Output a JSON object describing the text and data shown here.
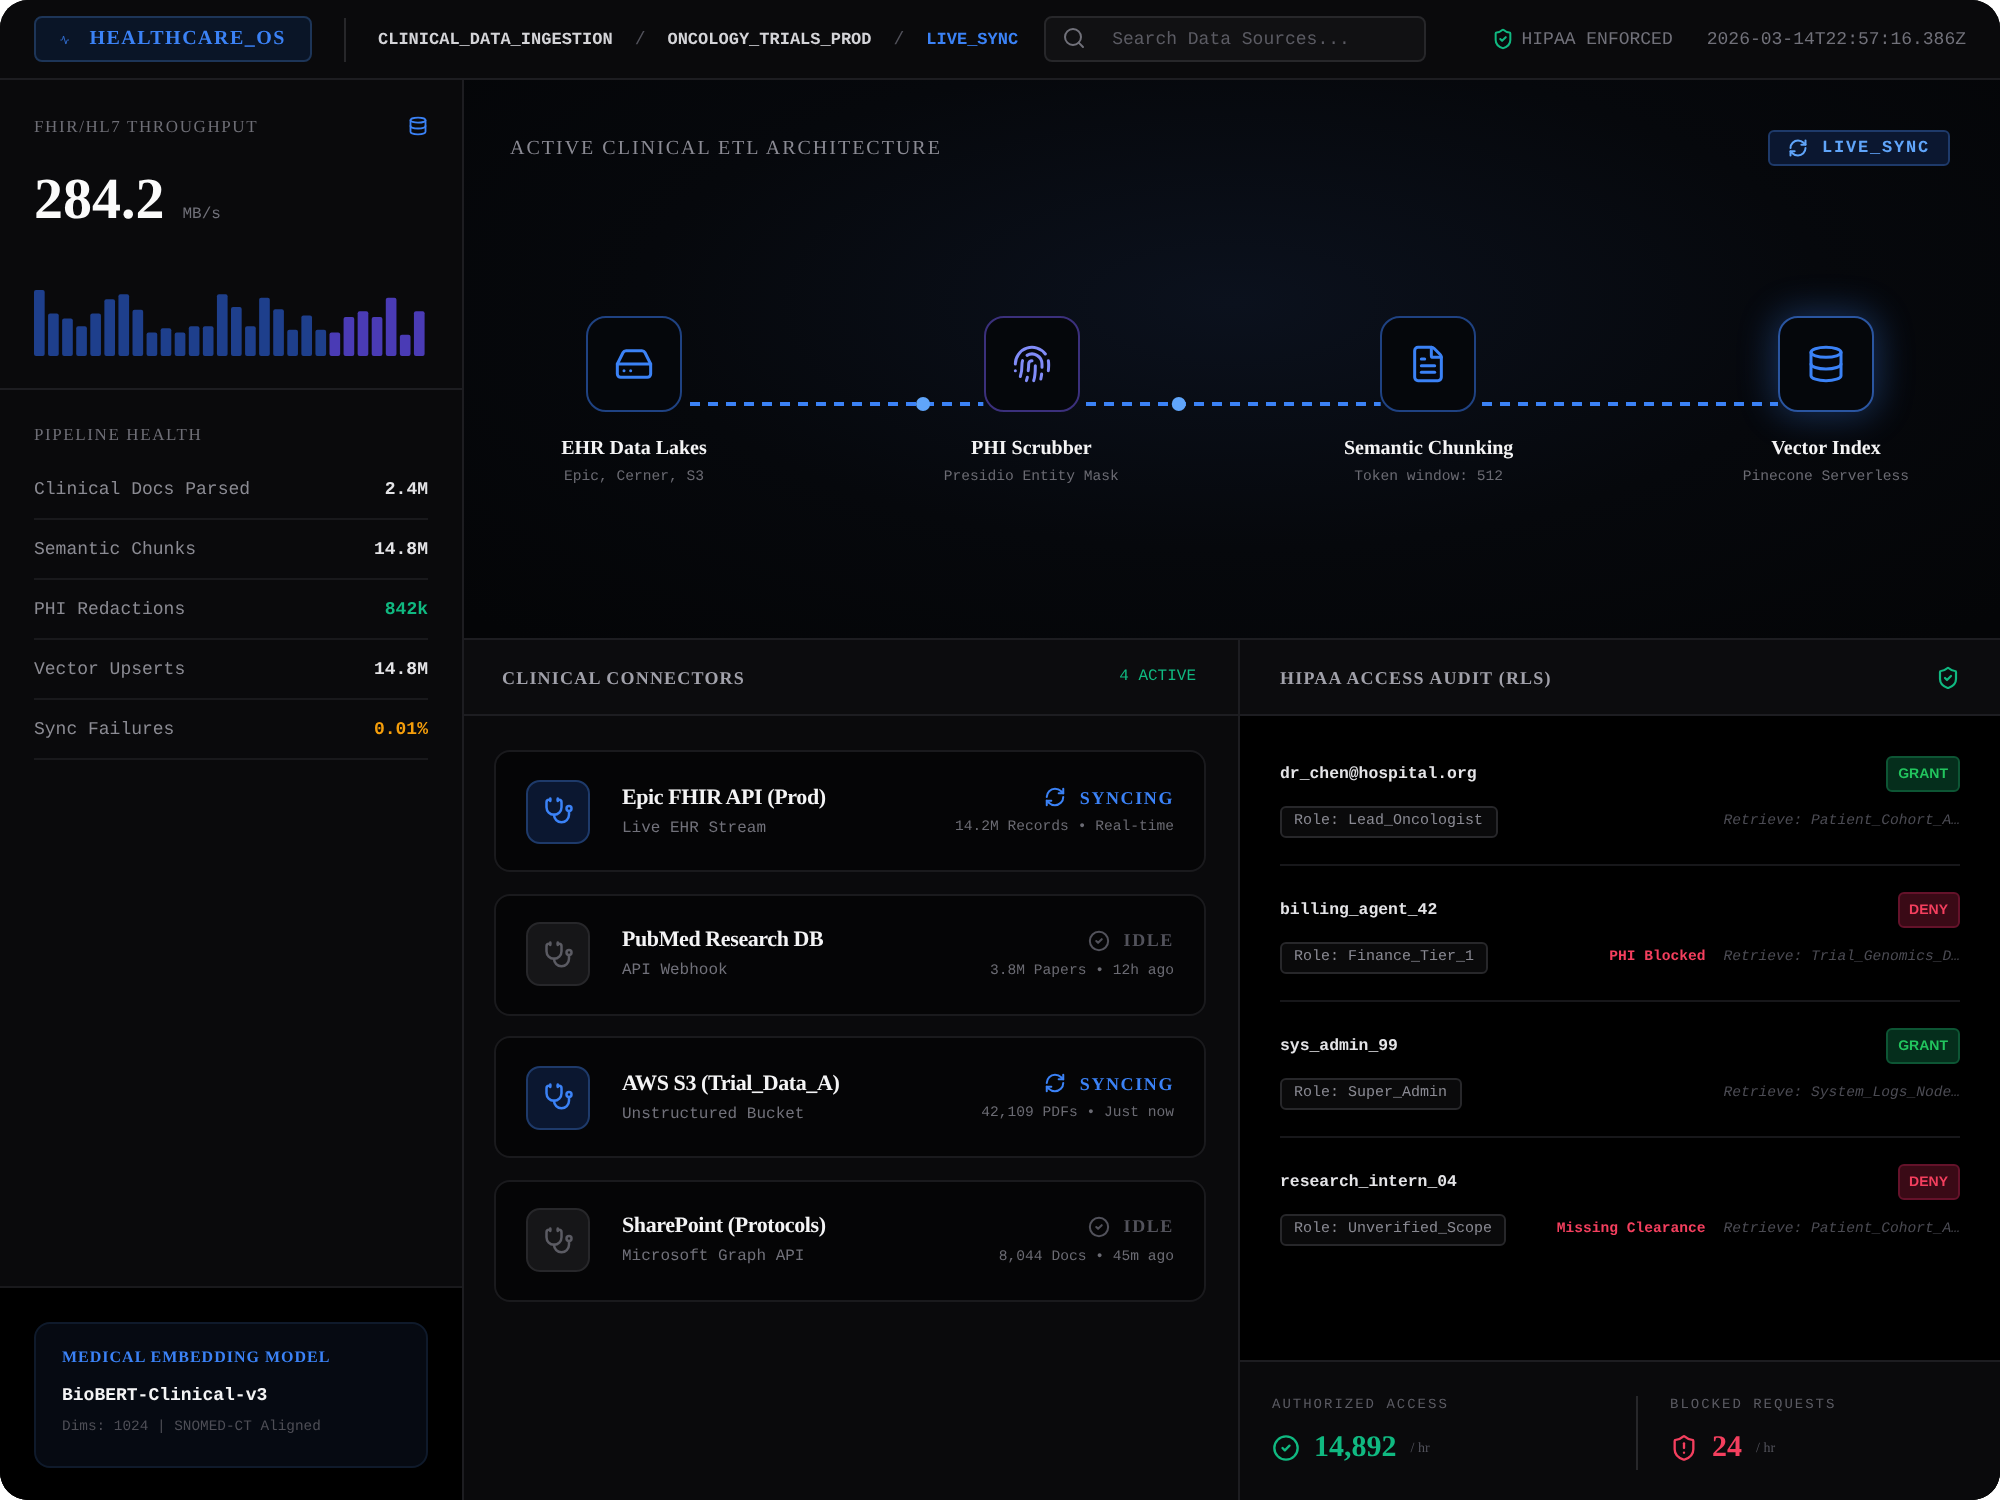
{
  "header": {
    "logo": "HEALTHCARE_OS",
    "breadcrumbs": [
      {
        "label": "CLINICAL_DATA_INGESTION",
        "selected": false
      },
      {
        "separator": "/",
        "label": "ONCOLOGY_TRIALS_PROD",
        "selected": false
      },
      {
        "separator": "/",
        "label": "LIVE_SYNC",
        "selected": true
      }
    ],
    "search": {
      "placeholder": "Search Data Sources..."
    },
    "compliance": "HIPAA ENFORCED",
    "timestamp": "2026-03-14T22:57:16.386Z"
  },
  "sidebar": {
    "throughput": {
      "title": "FHIR/HL7 THROUGHPUT",
      "value": "284.2",
      "unit": "MB/s"
    },
    "pipeline_health": {
      "title": "PIPELINE HEALTH",
      "rows": [
        {
          "label": "Clinical Docs Parsed",
          "value": "2.4M",
          "color": "#e4e4e7"
        },
        {
          "label": "Semantic Chunks",
          "value": "14.8M",
          "color": "#e4e4e7"
        },
        {
          "label": "PHI Redactions",
          "value": "842k",
          "color": "#10b981"
        },
        {
          "label": "Vector Upserts",
          "value": "14.8M",
          "color": "#e4e4e7"
        },
        {
          "label": "Sync Failures",
          "value": "0.01%",
          "color": "#f59e0b"
        }
      ]
    },
    "model_card": {
      "title": "MEDICAL EMBEDDING MODEL",
      "name": "BioBERT-Clinical-v3",
      "details": "Dims: 1024 | SNOMED-CT Aligned"
    }
  },
  "architecture": {
    "title": "ACTIVE CLINICAL ETL ARCHITECTURE",
    "badge": "LIVE_SYNC",
    "nodes": [
      {
        "kind": "storage",
        "label": "EHR Data Lakes",
        "detail": "Epic, Cerner, S3",
        "highlighted": false
      },
      {
        "kind": "scrubber",
        "label": "PHI Scrubber",
        "detail": "Presidio Entity Mask",
        "highlighted": false
      },
      {
        "kind": "document",
        "label": "Semantic Chunking",
        "detail": "Token window: 512",
        "highlighted": false
      },
      {
        "kind": "vector",
        "label": "Vector Index",
        "detail": "Pinecone Serverless",
        "highlighted": true
      }
    ],
    "links": [
      {
        "packet": true
      },
      {
        "packet": true
      },
      {
        "packet": false
      }
    ]
  },
  "connectors": {
    "title": "CLINICAL CONNECTORS",
    "count": "4 ACTIVE",
    "items": [
      {
        "kind": "syncing",
        "name": "Epic FHIR API (Prod)",
        "source": "Live EHR Stream",
        "status_label": "SYNCING",
        "stats": "14.2M Records • Real-time"
      },
      {
        "kind": "idle",
        "name": "PubMed Research DB",
        "source": "API Webhook",
        "status_label": "IDLE",
        "stats": "3.8M Papers • 12h ago"
      },
      {
        "kind": "syncing",
        "name": "AWS S3 (Trial_Data_A)",
        "source": "Unstructured Bucket",
        "status_label": "SYNCING",
        "stats": "42,109 PDFs • Just now"
      },
      {
        "kind": "idle",
        "name": "SharePoint (Protocols)",
        "source": "Microsoft Graph API",
        "status_label": "IDLE",
        "stats": "8,044 Docs • 45m ago"
      }
    ]
  },
  "audit": {
    "title": "HIPAA ACCESS AUDIT (RLS)",
    "entries": [
      {
        "kind": "grant",
        "user": "dr_chen@hospital.org",
        "decision_label": "GRANT",
        "role": "Role: Lead_Oncologist",
        "query": "Retrieve: Patient_Cohort_A…"
      },
      {
        "kind": "deny",
        "user": "billing_agent_42",
        "decision_label": "DENY",
        "role": "Role: Finance_Tier_1",
        "reason": "PHI Blocked",
        "query": "Retrieve: Trial_Genomics_D…"
      },
      {
        "kind": "grant",
        "user": "sys_admin_99",
        "decision_label": "GRANT",
        "role": "Role: Super_Admin",
        "query": "Retrieve: System_Logs_Node…"
      },
      {
        "kind": "deny",
        "user": "research_intern_04",
        "decision_label": "DENY",
        "role": "Role: Unverified_Scope",
        "reason": "Missing Clearance",
        "query": "Retrieve: Patient_Cohort_A…"
      }
    ],
    "summary": [
      {
        "kind": "authorized",
        "label": "AUTHORIZED ACCESS",
        "value": "14,892",
        "unit": "/ hr"
      },
      {
        "kind": "blocked",
        "label": "BLOCKED REQUESTS",
        "value": "24",
        "unit": "/ hr"
      }
    ]
  }
}
